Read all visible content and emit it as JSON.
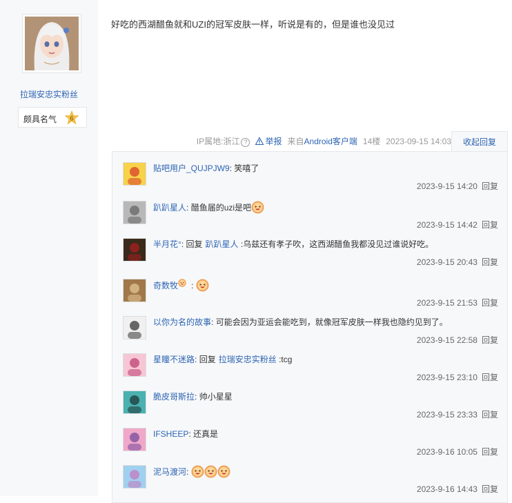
{
  "author": {
    "name": "拉瑞安忠实粉丝",
    "level_name": "颇具名气",
    "level_num": "6"
  },
  "post": {
    "text": "好吃的西湖醋鱼就和UZI的冠军皮肤一样，听说是有的，但是谁也没见过",
    "ip": "IP属地:浙江",
    "report": "举报",
    "client": "来自Android客户端",
    "floor": "14楼",
    "time": "2023-09-15 14:03",
    "collapse": "收起回复"
  },
  "replies": [
    {
      "author": "贴吧用户_QUJPJW9",
      "sep": ":",
      "text": "笑嘻了",
      "reply_kw": "",
      "target": "",
      "time": "2023-9-15 14:20",
      "reply": "回复"
    },
    {
      "author": "趴趴星人",
      "sep": ":",
      "text": "醋鱼届的uzi是吧",
      "reply_kw": "",
      "target": "",
      "time": "2023-9-15 14:42",
      "reply": "回复"
    },
    {
      "author": "半月花°",
      "sep": ":",
      "text": ":乌兹还有孝子吹，这西湖醋鱼我都没见过谁说好吃。",
      "reply_kw": "回复",
      "target": "趴趴星人",
      "time": "2023-9-15 20:43",
      "reply": "回复"
    },
    {
      "author": "奇数牧",
      "sep": ":",
      "text": "",
      "reply_kw": "",
      "target": "",
      "time": "2023-9-15 21:53",
      "reply": "回复"
    },
    {
      "author": "以你为名的故事",
      "sep": ":",
      "text": "可能会因为亚运会能吃到，就像冠军皮肤一样我也隐约见到了。",
      "reply_kw": "",
      "target": "",
      "time": "2023-9-15 22:58",
      "reply": "回复"
    },
    {
      "author": "星瞳不迷路",
      "sep": ":",
      "text": ":tcg",
      "reply_kw": "回复",
      "target": "拉瑞安忠实粉丝",
      "time": "2023-9-15 23:10",
      "reply": "回复"
    },
    {
      "author": "脆皮哥斯拉",
      "sep": ":",
      "text": "帅小星星",
      "reply_kw": "",
      "target": "",
      "time": "2023-9-15 23:33",
      "reply": "回复"
    },
    {
      "author": "IFSHEEP",
      "sep": ":",
      "text": "还真是",
      "reply_kw": "",
      "target": "",
      "time": "2023-9-16 10:05",
      "reply": "回复"
    },
    {
      "author": "泥马渡河",
      "sep": ":",
      "text": "",
      "reply_kw": "",
      "target": "",
      "time": "2023-9-16 14:43",
      "reply": "回复"
    }
  ],
  "colors": {
    "link": "#2d64b3",
    "panel_bg": "#f7f8fa",
    "badge": "#f5c242"
  },
  "icons": {
    "emoji": "grinning-emoji",
    "report": "warning-triangle-icon",
    "ip_help": "question-circle-icon"
  }
}
